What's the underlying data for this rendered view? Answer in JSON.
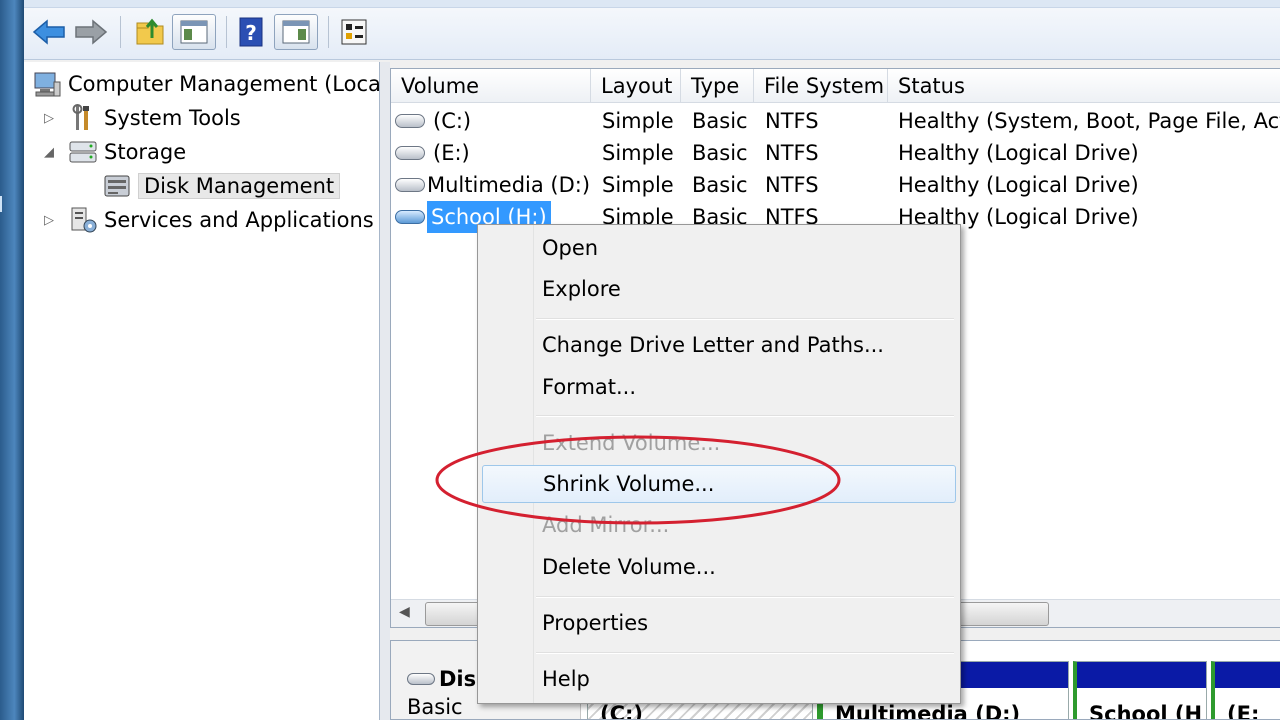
{
  "toolbar": {
    "buttons": [
      "back-arrow-icon",
      "forward-arrow-icon",
      "up-folder-icon",
      "show-hide-console-tree-icon",
      "help-icon",
      "action-pane-icon",
      "properties-icon"
    ]
  },
  "tree": {
    "root": "Computer Management (Local",
    "items": [
      {
        "label": "System Tools",
        "expander": "▷"
      },
      {
        "label": "Storage",
        "expander": "◢"
      },
      {
        "label": "Disk Management"
      },
      {
        "label": "Services and Applications",
        "expander": "▷"
      }
    ]
  },
  "list": {
    "columns": [
      "Volume",
      "Layout",
      "Type",
      "File System",
      "Status"
    ],
    "rows": [
      {
        "volume": "(C:)",
        "layout": "Simple",
        "type": "Basic",
        "fs": "NTFS",
        "status": "Healthy (System, Boot, Page File, Active"
      },
      {
        "volume": "(E:)",
        "layout": "Simple",
        "type": "Basic",
        "fs": "NTFS",
        "status": "Healthy (Logical Drive)"
      },
      {
        "volume": "Multimedia (D:)",
        "layout": "Simple",
        "type": "Basic",
        "fs": "NTFS",
        "status": "Healthy (Logical Drive)"
      },
      {
        "volume": "School (H:)",
        "layout": "Simple",
        "type": "Basic",
        "fs": "NTFS",
        "status": "Healthy (Logical Drive)"
      }
    ],
    "selected_volume": "School (H:)"
  },
  "context_menu": {
    "items": [
      {
        "label": "Open",
        "enabled": true
      },
      {
        "label": "Explore",
        "enabled": true
      },
      {
        "label": "Change Drive Letter and Paths...",
        "enabled": true
      },
      {
        "label": "Format...",
        "enabled": true
      },
      {
        "label": "Extend Volume...",
        "enabled": false
      },
      {
        "label": "Shrink Volume...",
        "enabled": true,
        "highlighted": true
      },
      {
        "label": "Add Mirror...",
        "enabled": false
      },
      {
        "label": "Delete Volume...",
        "enabled": true
      },
      {
        "label": "Properties",
        "enabled": true
      },
      {
        "label": "Help",
        "enabled": true
      }
    ]
  },
  "disk_pane": {
    "disk_label": "Disl",
    "disk_type": "Basic",
    "partitions": [
      "(C:)",
      "Multimedia (D:)",
      "School (H",
      "(E:"
    ]
  },
  "colors": {
    "selection": "#3399ff",
    "partition_bar": "#0a1aa6",
    "annotation": "#d42030"
  }
}
